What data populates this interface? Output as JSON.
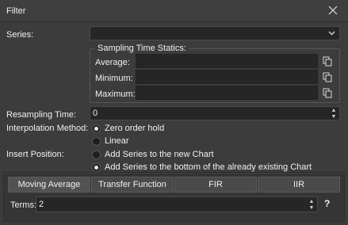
{
  "window": {
    "title": "Filter",
    "close_icon": "close-icon"
  },
  "series": {
    "label": "Series:",
    "value": ""
  },
  "sampling": {
    "title": "Sampling Time Statics:",
    "rows": [
      {
        "label": "Average:",
        "value": ""
      },
      {
        "label": "Minimum:",
        "value": ""
      },
      {
        "label": "Maximum:",
        "value": ""
      }
    ]
  },
  "resampling": {
    "label": "Resampling Time:",
    "value": "0"
  },
  "interpolation": {
    "label": "Interpolation Method:",
    "options": [
      "Zero order hold",
      "Linear"
    ],
    "selected": 0
  },
  "insert": {
    "label": "Insert Position:",
    "options": [
      "Add Series to the new Chart",
      "Add Series to the bottom of the already existing Chart"
    ],
    "selected": 1
  },
  "tabs": [
    "Moving Average",
    "Transfer Function",
    "FIR",
    "IIR"
  ],
  "active_tab": 0,
  "terms": {
    "label": "Terms:",
    "value": "2"
  },
  "help_label": "?",
  "colors": {
    "background": "#3c3c3c",
    "field": "#262626",
    "text": "#f0f0f0"
  }
}
